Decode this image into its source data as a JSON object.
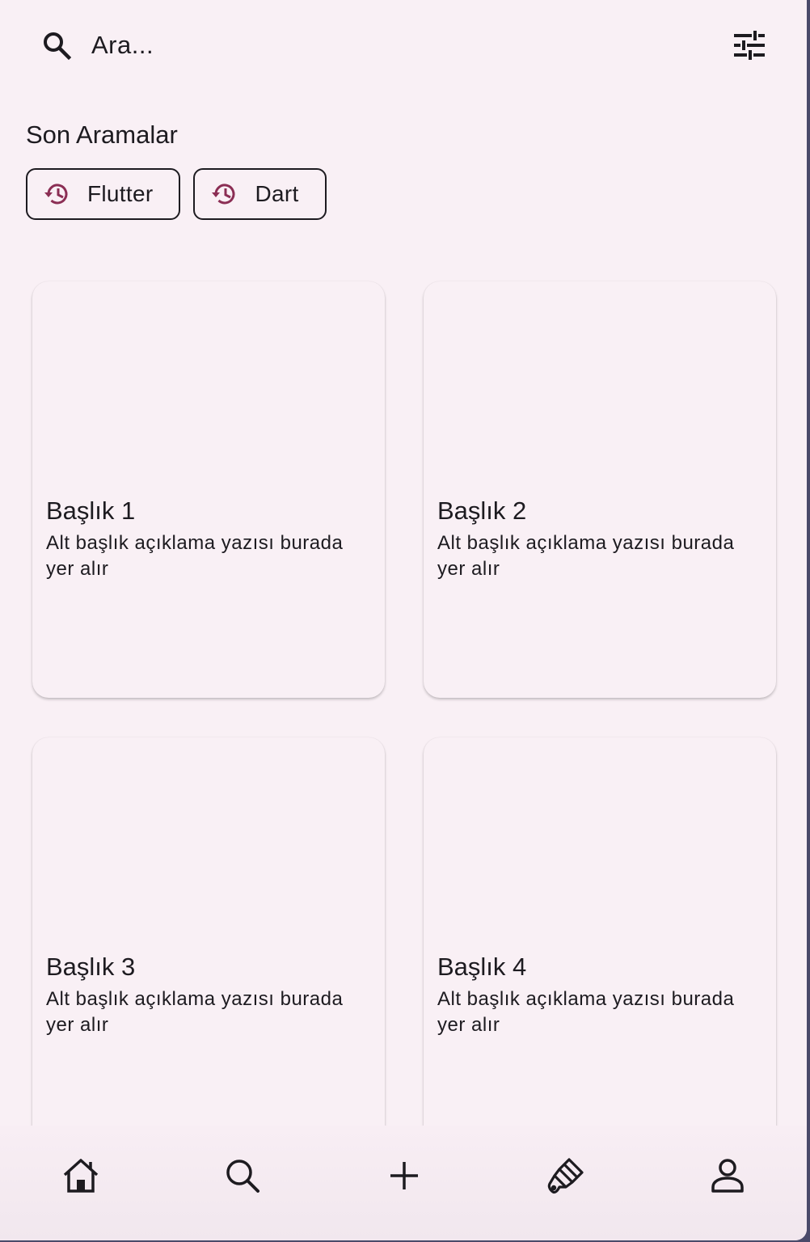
{
  "search": {
    "placeholder": "Ara..."
  },
  "recent": {
    "title": "Son Aramalar",
    "chips": [
      {
        "label": "Flutter",
        "icon": "history-icon"
      },
      {
        "label": "Dart",
        "icon": "history-icon"
      }
    ]
  },
  "cards": [
    {
      "title": "Başlık 1",
      "subtitle": "Alt başlık açıklama yazısı burada yer alır"
    },
    {
      "title": "Başlık 2",
      "subtitle": "Alt başlık açıklama yazısı burada yer alır"
    },
    {
      "title": "Başlık 3",
      "subtitle": "Alt başlık açıklama yazısı burada yer alır"
    },
    {
      "title": "Başlık 4",
      "subtitle": "Alt başlık açıklama yazısı burada yer alır"
    }
  ],
  "nav": {
    "items": [
      {
        "icon": "home-icon"
      },
      {
        "icon": "search-icon"
      },
      {
        "icon": "add-icon"
      },
      {
        "icon": "brush-icon"
      },
      {
        "icon": "profile-icon"
      }
    ]
  },
  "colors": {
    "background": "#f9f0f5",
    "accent": "#8b2e54",
    "text": "#1d1b20"
  }
}
